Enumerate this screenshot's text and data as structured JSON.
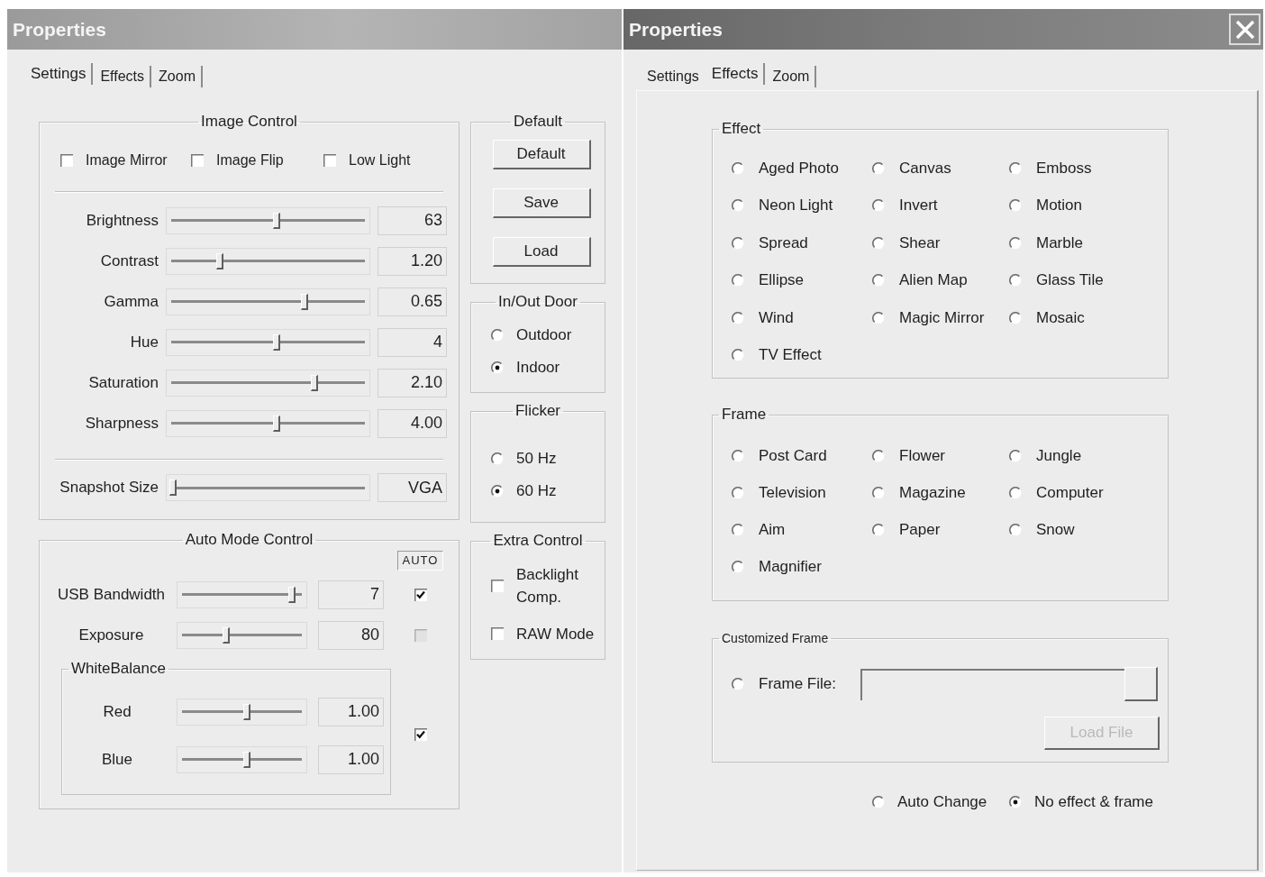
{
  "settings_window": {
    "title": "Properties",
    "active": false,
    "close_button": false,
    "tabs": [
      {
        "label": "Settings",
        "selected": true
      },
      {
        "label": "Effects",
        "selected": false
      },
      {
        "label": "Zoom",
        "selected": false
      }
    ],
    "image_control": {
      "title": "Image Control",
      "checkboxes": [
        {
          "label": "Image Mirror",
          "checked": false
        },
        {
          "label": "Image Flip",
          "checked": false
        },
        {
          "label": "Low Light",
          "checked": false
        }
      ],
      "sliders": [
        {
          "label": "Brightness",
          "level": 0.54,
          "value": "63"
        },
        {
          "label": "Contrast",
          "level": 0.26,
          "value": "1.20"
        },
        {
          "label": "Gamma",
          "level": 0.68,
          "value": "0.65"
        },
        {
          "label": "Hue",
          "level": 0.54,
          "value": "4"
        },
        {
          "label": "Saturation",
          "level": 0.73,
          "value": "2.10"
        },
        {
          "label": "Sharpness",
          "level": 0.54,
          "value": "4.00"
        }
      ],
      "snapshot": {
        "label": "Snapshot Size",
        "level": 0.03,
        "value": "VGA"
      }
    },
    "default_group": {
      "title": "Default",
      "buttons": [
        "Default",
        "Save",
        "Load"
      ]
    },
    "in_out_door": {
      "title": "In/Out Door",
      "options": [
        {
          "label": "Outdoor",
          "selected": false
        },
        {
          "label": "Indoor",
          "selected": true
        }
      ]
    },
    "flicker": {
      "title": "Flicker",
      "options": [
        {
          "label": "50 Hz",
          "selected": false
        },
        {
          "label": "60 Hz",
          "selected": true
        }
      ]
    },
    "auto_mode": {
      "title": "Auto Mode Control",
      "auto_label": "AUTO",
      "rows": [
        {
          "label": "USB Bandwidth",
          "level": 0.89,
          "value": "7",
          "auto": {
            "checked": true,
            "disabled": false
          }
        },
        {
          "label": "Exposure",
          "level": 0.38,
          "value": "80",
          "auto": {
            "checked": false,
            "disabled": true
          }
        }
      ],
      "white_balance": {
        "title": "WhiteBalance",
        "rows": [
          {
            "label": "Red",
            "level": 0.54,
            "value": "1.00"
          },
          {
            "label": "Blue",
            "level": 0.54,
            "value": "1.00"
          }
        ],
        "auto": {
          "checked": true,
          "disabled": false
        }
      }
    },
    "extra_control": {
      "title": "Extra Control",
      "checkboxes": [
        {
          "label": "Backlight Comp.",
          "checked": false
        },
        {
          "label": "RAW Mode",
          "checked": false
        }
      ]
    }
  },
  "effects_window": {
    "title": "Properties",
    "active": true,
    "close_button": true,
    "tabs": [
      {
        "label": "Settings",
        "selected": false
      },
      {
        "label": "Effects",
        "selected": true
      },
      {
        "label": "Zoom",
        "selected": false
      }
    ],
    "effect": {
      "title": "Effect",
      "options": [
        {
          "label": "Aged Photo",
          "selected": false
        },
        {
          "label": "Canvas",
          "selected": false
        },
        {
          "label": "Emboss",
          "selected": false
        },
        {
          "label": "Neon Light",
          "selected": false
        },
        {
          "label": "Invert",
          "selected": false
        },
        {
          "label": "Motion",
          "selected": false
        },
        {
          "label": "Spread",
          "selected": false
        },
        {
          "label": "Shear",
          "selected": false
        },
        {
          "label": "Marble",
          "selected": false
        },
        {
          "label": "Ellipse",
          "selected": false
        },
        {
          "label": "Alien Map",
          "selected": false
        },
        {
          "label": "Glass Tile",
          "selected": false
        },
        {
          "label": "Wind",
          "selected": false
        },
        {
          "label": "Magic Mirror",
          "selected": false
        },
        {
          "label": "Mosaic",
          "selected": false
        },
        {
          "label": "TV Effect",
          "selected": false
        }
      ]
    },
    "frame": {
      "title": "Frame",
      "options": [
        {
          "label": "Post Card",
          "selected": false
        },
        {
          "label": "Flower",
          "selected": false
        },
        {
          "label": "Jungle",
          "selected": false
        },
        {
          "label": "Television",
          "selected": false
        },
        {
          "label": "Magazine",
          "selected": false
        },
        {
          "label": "Computer",
          "selected": false
        },
        {
          "label": "Aim",
          "selected": false
        },
        {
          "label": "Paper",
          "selected": false
        },
        {
          "label": "Snow",
          "selected": false
        },
        {
          "label": "Magnifier",
          "selected": false
        }
      ]
    },
    "customized_frame": {
      "title": "Customized Frame",
      "option": {
        "label": "Frame File:",
        "selected": false
      },
      "load_button": {
        "label": "Load File",
        "disabled": true
      }
    },
    "modes": [
      {
        "label": "Auto Change",
        "selected": false
      },
      {
        "label": "No effect & frame",
        "selected": true
      }
    ]
  }
}
